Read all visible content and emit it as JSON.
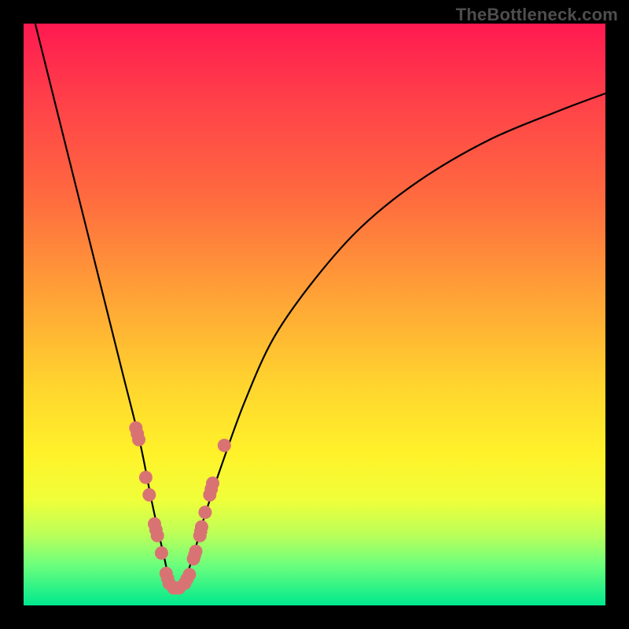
{
  "watermark": "TheBottleneck.com",
  "colors": {
    "marker": "#d97373",
    "curve": "#000000",
    "frame": "#000000"
  },
  "chart_data": {
    "type": "line",
    "title": "",
    "xlabel": "",
    "ylabel": "",
    "xlim": [
      0,
      100
    ],
    "ylim": [
      0,
      100
    ],
    "description": "V-shaped bottleneck curve over green-yellow-red vertical gradient; minimum near the bottom-left third, with salmon markers clustered near the minimum.",
    "series": [
      {
        "name": "bottleneck_curve",
        "x": [
          2,
          5,
          8,
          11,
          14,
          17,
          20,
          22,
          24,
          25.5,
          27,
          29,
          31,
          34,
          38,
          43,
          50,
          58,
          68,
          80,
          92,
          100
        ],
        "y": [
          100,
          88,
          76,
          64,
          52,
          40,
          28,
          18,
          9,
          3,
          3,
          8,
          15,
          24,
          35,
          46,
          56,
          65,
          73,
          80,
          85,
          88
        ]
      }
    ],
    "markers": {
      "name": "highlighted_points",
      "points": [
        {
          "x": 19.3,
          "y": 30.5
        },
        {
          "x": 19.8,
          "y": 28.5
        },
        {
          "x": 21.0,
          "y": 22.0
        },
        {
          "x": 21.6,
          "y": 19.0
        },
        {
          "x": 22.5,
          "y": 14.0
        },
        {
          "x": 23.0,
          "y": 12.0
        },
        {
          "x": 23.7,
          "y": 9.0
        },
        {
          "x": 24.5,
          "y": 5.5
        },
        {
          "x": 25.0,
          "y": 3.8
        },
        {
          "x": 25.8,
          "y": 3.0
        },
        {
          "x": 26.7,
          "y": 3.0
        },
        {
          "x": 27.7,
          "y": 3.8
        },
        {
          "x": 28.5,
          "y": 5.3
        },
        {
          "x": 29.2,
          "y": 8.0
        },
        {
          "x": 29.6,
          "y": 9.3
        },
        {
          "x": 30.3,
          "y": 12.0
        },
        {
          "x": 30.6,
          "y": 13.5
        },
        {
          "x": 31.2,
          "y": 16.0
        },
        {
          "x": 32.0,
          "y": 19.0
        },
        {
          "x": 32.5,
          "y": 21.0
        },
        {
          "x": 34.5,
          "y": 27.5
        }
      ]
    }
  }
}
